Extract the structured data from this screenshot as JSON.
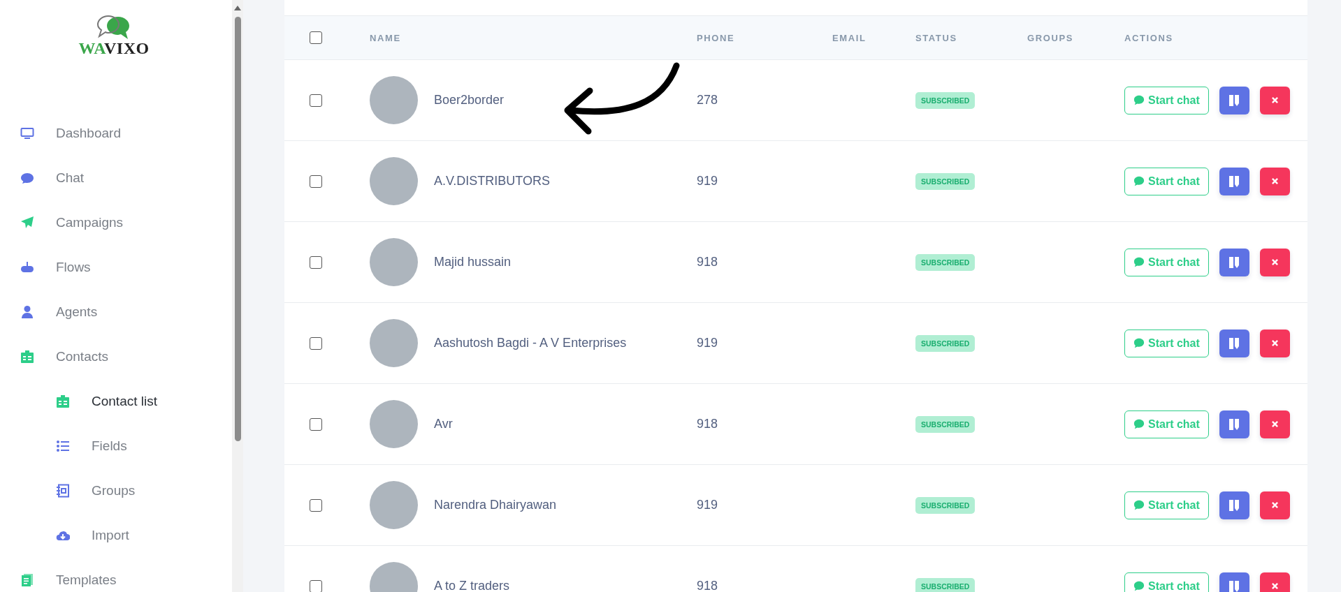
{
  "logo": {
    "part_1": "WA",
    "part_2": "VIXO"
  },
  "sidebar": {
    "items": [
      {
        "label": "Dashboard",
        "selected": false
      },
      {
        "label": "Chat",
        "selected": false
      },
      {
        "label": "Campaigns",
        "selected": false
      },
      {
        "label": "Flows",
        "selected": false
      },
      {
        "label": "Agents",
        "selected": false
      },
      {
        "label": "Contacts",
        "selected": false,
        "children": [
          {
            "label": "Contact list",
            "selected": true
          },
          {
            "label": "Fields",
            "selected": false
          },
          {
            "label": "Groups",
            "selected": false
          },
          {
            "label": "Import",
            "selected": false
          }
        ]
      },
      {
        "label": "Templates",
        "selected": false
      }
    ]
  },
  "table": {
    "columns": [
      "NAME",
      "PHONE",
      "EMAIL",
      "STATUS",
      "GROUPS",
      "ACTIONS"
    ],
    "header_checked": false,
    "rows": [
      {
        "checked": false,
        "name": "Boer2border",
        "phone": "278",
        "status": "SUBSCRIBED",
        "chat_button": "Start chat"
      },
      {
        "checked": false,
        "name": "A.V.DISTRIBUTORS",
        "phone": "919",
        "status": "SUBSCRIBED",
        "chat_button": "Start chat"
      },
      {
        "checked": false,
        "name": "Majid hussain",
        "phone": "918",
        "status": "SUBSCRIBED",
        "chat_button": "Start chat"
      },
      {
        "checked": false,
        "name": "Aashutosh Bagdi - A V Enterprises",
        "phone": "919",
        "status": "SUBSCRIBED",
        "chat_button": "Start chat"
      },
      {
        "checked": false,
        "name": "Avr",
        "phone": "918",
        "status": "SUBSCRIBED",
        "chat_button": "Start chat"
      },
      {
        "checked": false,
        "name": "Narendra Dhairyawan",
        "phone": "919",
        "status": "SUBSCRIBED",
        "chat_button": "Start chat"
      },
      {
        "checked": false,
        "name": "A to Z traders",
        "phone": "918",
        "status": "SUBSCRIBED",
        "chat_button": "Start chat"
      }
    ]
  }
}
